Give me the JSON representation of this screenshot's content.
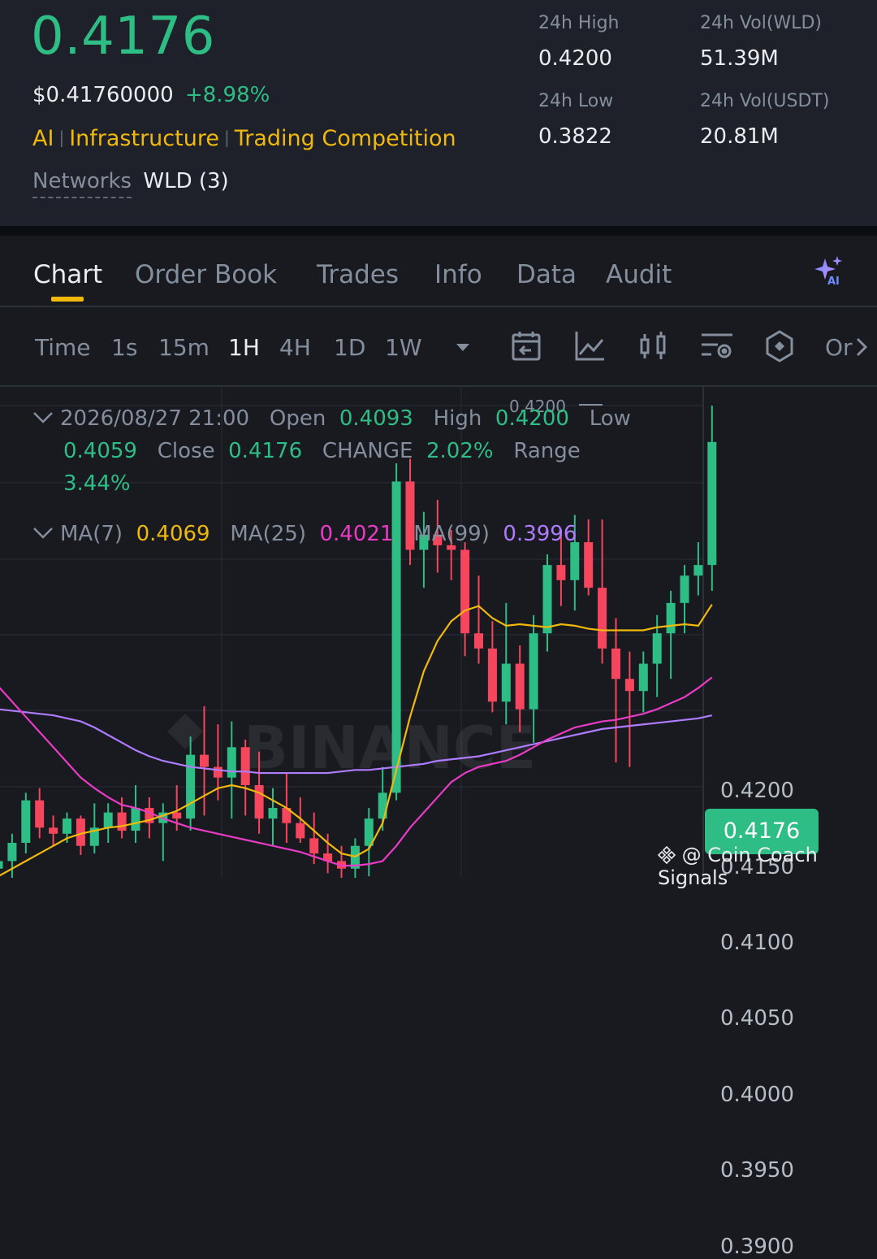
{
  "header": {
    "price": "0.4176",
    "usd_price": "$0.41760000",
    "change_pct": "+8.98%",
    "tags": [
      "AI",
      "Infrastructure",
      "Trading Competition"
    ],
    "networks_label": "Networks",
    "networks_value": "WLD (3)",
    "stats": {
      "high_label": "24h High",
      "high_value": "0.4200",
      "low_label": "24h Low",
      "low_value": "0.3822",
      "vol_wld_label": "24h Vol(WLD)",
      "vol_wld_value": "51.39M",
      "vol_usdt_label": "24h Vol(USDT)",
      "vol_usdt_value": "20.81M"
    }
  },
  "tabs": [
    "Chart",
    "Order Book",
    "Trades",
    "Info",
    "Data",
    "Audit"
  ],
  "toolbar": {
    "intervals": [
      "Time",
      "1s",
      "15m",
      "1H",
      "4H",
      "1D",
      "1W"
    ],
    "active_interval": "1H",
    "overflow_text": "Or"
  },
  "candle_info": {
    "datetime": "2026/08/27 21:00",
    "open_label": "Open",
    "open": "0.4093",
    "high_label": "High",
    "high": "0.4200",
    "low_label": "Low",
    "low": "0.4059",
    "close_label": "Close",
    "close": "0.4176",
    "change_label": "CHANGE",
    "change": "2.02%",
    "range_label": "Range",
    "range": "3.44%"
  },
  "ma_info": {
    "ma7_label": "MA(7)",
    "ma7": "0.4069",
    "ma25_label": "MA(25)",
    "ma25": "0.4021",
    "ma99_label": "MA(99)",
    "ma99": "0.3996"
  },
  "chart": {
    "current_price_tag": "0.4176",
    "high_marker": "0.4200",
    "y_ticks": [
      "0.4200",
      "0.4150",
      "0.4100",
      "0.4050",
      "0.4000",
      "0.3950",
      "0.3900"
    ],
    "watermark_logo": "BINANCE",
    "up_color": "#2ebd85",
    "down_color": "#f6465d"
  },
  "chart_data": {
    "type": "candlestick",
    "y_range": [
      0.3895,
      0.4225
    ],
    "series": [
      {
        "name": "MA(7)",
        "color": "#f0b90b"
      },
      {
        "name": "MA(25)",
        "color": "#e93bc5"
      },
      {
        "name": "MA(99)",
        "color": "#b07cff"
      }
    ],
    "candles": [
      {
        "o": 0.3895,
        "h": 0.3902,
        "l": 0.388,
        "c": 0.39
      },
      {
        "o": 0.39,
        "h": 0.3918,
        "l": 0.3888,
        "c": 0.3912
      },
      {
        "o": 0.3912,
        "h": 0.3945,
        "l": 0.3905,
        "c": 0.394
      },
      {
        "o": 0.394,
        "h": 0.3948,
        "l": 0.3915,
        "c": 0.3922
      },
      {
        "o": 0.3922,
        "h": 0.393,
        "l": 0.391,
        "c": 0.3918
      },
      {
        "o": 0.3918,
        "h": 0.3932,
        "l": 0.3912,
        "c": 0.3928
      },
      {
        "o": 0.3928,
        "h": 0.393,
        "l": 0.3904,
        "c": 0.391
      },
      {
        "o": 0.391,
        "h": 0.3938,
        "l": 0.3905,
        "c": 0.3922
      },
      {
        "o": 0.3922,
        "h": 0.3938,
        "l": 0.3912,
        "c": 0.3932
      },
      {
        "o": 0.3932,
        "h": 0.3942,
        "l": 0.3915,
        "c": 0.392
      },
      {
        "o": 0.392,
        "h": 0.395,
        "l": 0.3912,
        "c": 0.3935
      },
      {
        "o": 0.3935,
        "h": 0.3942,
        "l": 0.3915,
        "c": 0.3925
      },
      {
        "o": 0.3925,
        "h": 0.3938,
        "l": 0.39,
        "c": 0.3932
      },
      {
        "o": 0.3932,
        "h": 0.395,
        "l": 0.392,
        "c": 0.3928
      },
      {
        "o": 0.3928,
        "h": 0.3982,
        "l": 0.392,
        "c": 0.397
      },
      {
        "o": 0.397,
        "h": 0.4002,
        "l": 0.393,
        "c": 0.3962
      },
      {
        "o": 0.3962,
        "h": 0.399,
        "l": 0.394,
        "c": 0.3955
      },
      {
        "o": 0.3955,
        "h": 0.3992,
        "l": 0.3928,
        "c": 0.3975
      },
      {
        "o": 0.3975,
        "h": 0.398,
        "l": 0.393,
        "c": 0.395
      },
      {
        "o": 0.395,
        "h": 0.3972,
        "l": 0.3918,
        "c": 0.3928
      },
      {
        "o": 0.3928,
        "h": 0.3948,
        "l": 0.391,
        "c": 0.3935
      },
      {
        "o": 0.3935,
        "h": 0.3958,
        "l": 0.3912,
        "c": 0.3925
      },
      {
        "o": 0.3925,
        "h": 0.3942,
        "l": 0.3912,
        "c": 0.3915
      },
      {
        "o": 0.3915,
        "h": 0.3932,
        "l": 0.3898,
        "c": 0.3905
      },
      {
        "o": 0.3905,
        "h": 0.3918,
        "l": 0.3892,
        "c": 0.39
      },
      {
        "o": 0.39,
        "h": 0.391,
        "l": 0.3885,
        "c": 0.3895
      },
      {
        "o": 0.3895,
        "h": 0.3915,
        "l": 0.3885,
        "c": 0.391
      },
      {
        "o": 0.391,
        "h": 0.3935,
        "l": 0.389,
        "c": 0.3928
      },
      {
        "o": 0.3928,
        "h": 0.3962,
        "l": 0.392,
        "c": 0.3945
      },
      {
        "o": 0.3945,
        "h": 0.4162,
        "l": 0.394,
        "c": 0.415
      },
      {
        "o": 0.415,
        "h": 0.4165,
        "l": 0.4095,
        "c": 0.4105
      },
      {
        "o": 0.4105,
        "h": 0.413,
        "l": 0.408,
        "c": 0.4115
      },
      {
        "o": 0.4115,
        "h": 0.4138,
        "l": 0.409,
        "c": 0.4108
      },
      {
        "o": 0.4108,
        "h": 0.4118,
        "l": 0.4085,
        "c": 0.4105
      },
      {
        "o": 0.4105,
        "h": 0.411,
        "l": 0.4035,
        "c": 0.405
      },
      {
        "o": 0.405,
        "h": 0.4088,
        "l": 0.403,
        "c": 0.404
      },
      {
        "o": 0.404,
        "h": 0.4058,
        "l": 0.3998,
        "c": 0.4005
      },
      {
        "o": 0.4005,
        "h": 0.407,
        "l": 0.399,
        "c": 0.403
      },
      {
        "o": 0.403,
        "h": 0.4042,
        "l": 0.3985,
        "c": 0.4
      },
      {
        "o": 0.4,
        "h": 0.4062,
        "l": 0.3978,
        "c": 0.405
      },
      {
        "o": 0.405,
        "h": 0.4102,
        "l": 0.4038,
        "c": 0.4095
      },
      {
        "o": 0.4095,
        "h": 0.4118,
        "l": 0.4068,
        "c": 0.4085
      },
      {
        "o": 0.4085,
        "h": 0.4128,
        "l": 0.4065,
        "c": 0.411
      },
      {
        "o": 0.411,
        "h": 0.4125,
        "l": 0.4075,
        "c": 0.408
      },
      {
        "o": 0.408,
        "h": 0.4125,
        "l": 0.403,
        "c": 0.404
      },
      {
        "o": 0.404,
        "h": 0.406,
        "l": 0.3965,
        "c": 0.402
      },
      {
        "o": 0.402,
        "h": 0.4038,
        "l": 0.3962,
        "c": 0.4012
      },
      {
        "o": 0.4012,
        "h": 0.4038,
        "l": 0.3998,
        "c": 0.403
      },
      {
        "o": 0.403,
        "h": 0.4062,
        "l": 0.4008,
        "c": 0.405
      },
      {
        "o": 0.405,
        "h": 0.4078,
        "l": 0.402,
        "c": 0.407
      },
      {
        "o": 0.407,
        "h": 0.4095,
        "l": 0.405,
        "c": 0.4088
      },
      {
        "o": 0.4088,
        "h": 0.411,
        "l": 0.4075,
        "c": 0.4095
      },
      {
        "o": 0.4095,
        "h": 0.42,
        "l": 0.4078,
        "c": 0.4176
      }
    ],
    "ma7": [
      0.389,
      0.3895,
      0.39,
      0.3905,
      0.391,
      0.3915,
      0.3918,
      0.392,
      0.3922,
      0.3923,
      0.3925,
      0.3927,
      0.393,
      0.3933,
      0.3938,
      0.3943,
      0.3948,
      0.395,
      0.3948,
      0.3945,
      0.394,
      0.3935,
      0.3928,
      0.392,
      0.3912,
      0.3905,
      0.3903,
      0.3908,
      0.3925,
      0.396,
      0.3995,
      0.4025,
      0.4045,
      0.4058,
      0.4065,
      0.4068,
      0.406,
      0.4055,
      0.4056,
      0.4055,
      0.4054,
      0.4056,
      0.4055,
      0.4053,
      0.4052,
      0.4052,
      0.4052,
      0.4052,
      0.4054,
      0.4055,
      0.4056,
      0.4055,
      0.4069
    ],
    "ma25": [
      0.4015,
      0.4005,
      0.3995,
      0.3985,
      0.3975,
      0.3965,
      0.3955,
      0.3948,
      0.3942,
      0.3937,
      0.3935,
      0.3932,
      0.3928,
      0.3925,
      0.3922,
      0.392,
      0.3918,
      0.3916,
      0.3914,
      0.3912,
      0.391,
      0.3908,
      0.3906,
      0.3903,
      0.39,
      0.3897,
      0.3897,
      0.3898,
      0.39,
      0.391,
      0.3922,
      0.3932,
      0.3942,
      0.3952,
      0.3958,
      0.3962,
      0.3964,
      0.3966,
      0.397,
      0.3975,
      0.398,
      0.3984,
      0.3988,
      0.399,
      0.3992,
      0.3993,
      0.3995,
      0.3997,
      0.4,
      0.4004,
      0.4008,
      0.4014,
      0.4021
    ],
    "ma99": [
      0.4,
      0.3999,
      0.3998,
      0.3997,
      0.3996,
      0.3994,
      0.3992,
      0.3988,
      0.3983,
      0.3978,
      0.3973,
      0.3969,
      0.3966,
      0.3964,
      0.3962,
      0.3961,
      0.396,
      0.3959,
      0.3959,
      0.3958,
      0.3958,
      0.3958,
      0.3958,
      0.3958,
      0.3958,
      0.3959,
      0.396,
      0.396,
      0.3961,
      0.3962,
      0.3963,
      0.3964,
      0.3966,
      0.3967,
      0.3968,
      0.3969,
      0.3971,
      0.3973,
      0.3975,
      0.3977,
      0.3979,
      0.3981,
      0.3983,
      0.3985,
      0.3987,
      0.3988,
      0.3989,
      0.399,
      0.3991,
      0.3992,
      0.3993,
      0.3994,
      0.3996
    ]
  },
  "footer": {
    "watermark": "@ Coin Coach Signals"
  }
}
